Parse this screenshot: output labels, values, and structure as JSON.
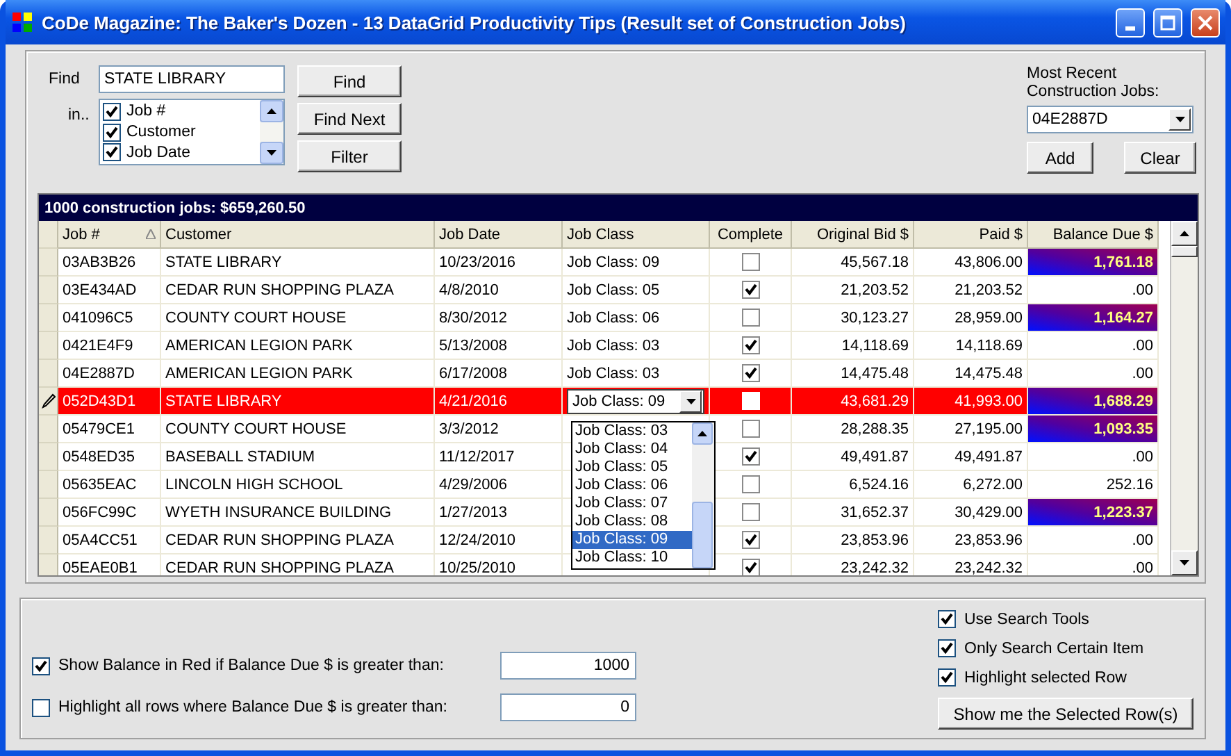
{
  "window": {
    "title": "CoDe Magazine: The Baker's Dozen - 13 DataGrid Productivity Tips  (Result set of Construction Jobs)"
  },
  "find": {
    "label": "Find",
    "value": "STATE LIBRARY",
    "in_label": "in..",
    "fields": [
      {
        "label": "Job #",
        "checked": true
      },
      {
        "label": "Customer",
        "checked": true
      },
      {
        "label": "Job Date",
        "checked": true
      }
    ],
    "buttons": [
      "Find",
      "Find Next",
      "Filter"
    ]
  },
  "recent": {
    "label": "Most  Recent Construction Jobs:",
    "value": "04E2887D",
    "buttons": [
      "Add",
      "Clear"
    ]
  },
  "grid": {
    "caption": "1000 construction jobs: $659,260.50",
    "columns": [
      "Job #",
      "Customer",
      "Job Date",
      "Job Class",
      "Complete",
      "Original Bid $",
      "Paid $",
      "Balance Due $"
    ],
    "rows": [
      {
        "job": "03AB3B26",
        "customer": "STATE LIBRARY",
        "date": "10/23/2016",
        "job_class": "Job Class: 09",
        "complete": false,
        "bid": "45,567.18",
        "paid": "43,806.00",
        "balance": "1,761.18",
        "highlighted": true,
        "selected": false,
        "editing": false
      },
      {
        "job": "03E434AD",
        "customer": "CEDAR RUN SHOPPING PLAZA",
        "date": "4/8/2010",
        "job_class": "Job Class: 05",
        "complete": true,
        "bid": "21,203.52",
        "paid": "21,203.52",
        "balance": ".00",
        "highlighted": false,
        "selected": false,
        "editing": false
      },
      {
        "job": "041096C5",
        "customer": "COUNTY COURT HOUSE",
        "date": "8/30/2012",
        "job_class": "Job Class: 06",
        "complete": false,
        "bid": "30,123.27",
        "paid": "28,959.00",
        "balance": "1,164.27",
        "highlighted": true,
        "selected": false,
        "editing": false
      },
      {
        "job": "0421E4F9",
        "customer": "AMERICAN LEGION PARK",
        "date": "5/13/2008",
        "job_class": "Job Class: 03",
        "complete": true,
        "bid": "14,118.69",
        "paid": "14,118.69",
        "balance": ".00",
        "highlighted": false,
        "selected": false,
        "editing": false
      },
      {
        "job": "04E2887D",
        "customer": "AMERICAN LEGION PARK",
        "date": "6/17/2008",
        "job_class": "Job Class: 03",
        "complete": true,
        "bid": "14,475.48",
        "paid": "14,475.48",
        "balance": ".00",
        "highlighted": false,
        "selected": false,
        "editing": false
      },
      {
        "job": "052D43D1",
        "customer": "STATE LIBRARY",
        "date": "4/21/2016",
        "complete": false,
        "bid": "43,681.29",
        "paid": "41,993.00",
        "balance": "1,688.29",
        "highlighted": true,
        "selected": true,
        "editing": true
      },
      {
        "job": "05479CE1",
        "customer": "COUNTY COURT HOUSE",
        "date": "3/3/2012",
        "complete": false,
        "bid": "28,288.35",
        "paid": "27,195.00",
        "balance": "1,093.35",
        "highlighted": true,
        "selected": false,
        "editing": false
      },
      {
        "job": "0548ED35",
        "customer": "BASEBALL STADIUM",
        "date": "11/12/2017",
        "complete": true,
        "bid": "49,491.87",
        "paid": "49,491.87",
        "balance": ".00",
        "highlighted": false,
        "selected": false,
        "editing": false
      },
      {
        "job": "05635EAC",
        "customer": "LINCOLN HIGH SCHOOL",
        "date": "4/29/2006",
        "complete": false,
        "bid": "6,524.16",
        "paid": "6,272.00",
        "balance": "252.16",
        "highlighted": false,
        "selected": false,
        "editing": false
      },
      {
        "job": "056FC99C",
        "customer": "WYETH INSURANCE BUILDING",
        "date": "1/27/2013",
        "complete": false,
        "bid": "31,652.37",
        "paid": "30,429.00",
        "balance": "1,223.37",
        "highlighted": true,
        "selected": false,
        "editing": false
      },
      {
        "job": "05A4CC51",
        "customer": "CEDAR RUN SHOPPING PLAZA",
        "date": "12/24/2010",
        "complete": true,
        "bid": "23,853.96",
        "paid": "23,853.96",
        "balance": ".00",
        "highlighted": false,
        "selected": false,
        "editing": false
      },
      {
        "job": "05EAE0B1",
        "customer": "CEDAR RUN SHOPPING PLAZA",
        "date": "10/25/2010",
        "complete": true,
        "bid": "23,242.32",
        "paid": "23,242.32",
        "balance": ".00",
        "highlighted": false,
        "selected": false,
        "editing": false
      }
    ],
    "dropdown": {
      "value": "Job Class: 09",
      "items": [
        {
          "label": "Job Class: 03",
          "selected": false
        },
        {
          "label": "Job Class: 04",
          "selected": false
        },
        {
          "label": "Job Class: 05",
          "selected": false
        },
        {
          "label": "Job Class: 06",
          "selected": false
        },
        {
          "label": "Job Class: 07",
          "selected": false
        },
        {
          "label": "Job Class: 08",
          "selected": false
        },
        {
          "label": "Job Class: 09",
          "selected": true
        },
        {
          "label": "Job Class: 10",
          "selected": false
        }
      ]
    }
  },
  "options": {
    "thresholds": [
      {
        "label": "Show Balance in Red if Balance Due $ is greater than:",
        "checked": true,
        "value": "1000"
      },
      {
        "label": "Highlight all rows where Balance Due $ is greater than:",
        "checked": false,
        "value": "0"
      }
    ],
    "checks": [
      {
        "label": "Use Search Tools",
        "checked": true
      },
      {
        "label": "Only Search Certain Item",
        "checked": true
      },
      {
        "label": "Highlight selected Row",
        "checked": true
      }
    ],
    "button": "Show me the Selected Row(s)"
  }
}
